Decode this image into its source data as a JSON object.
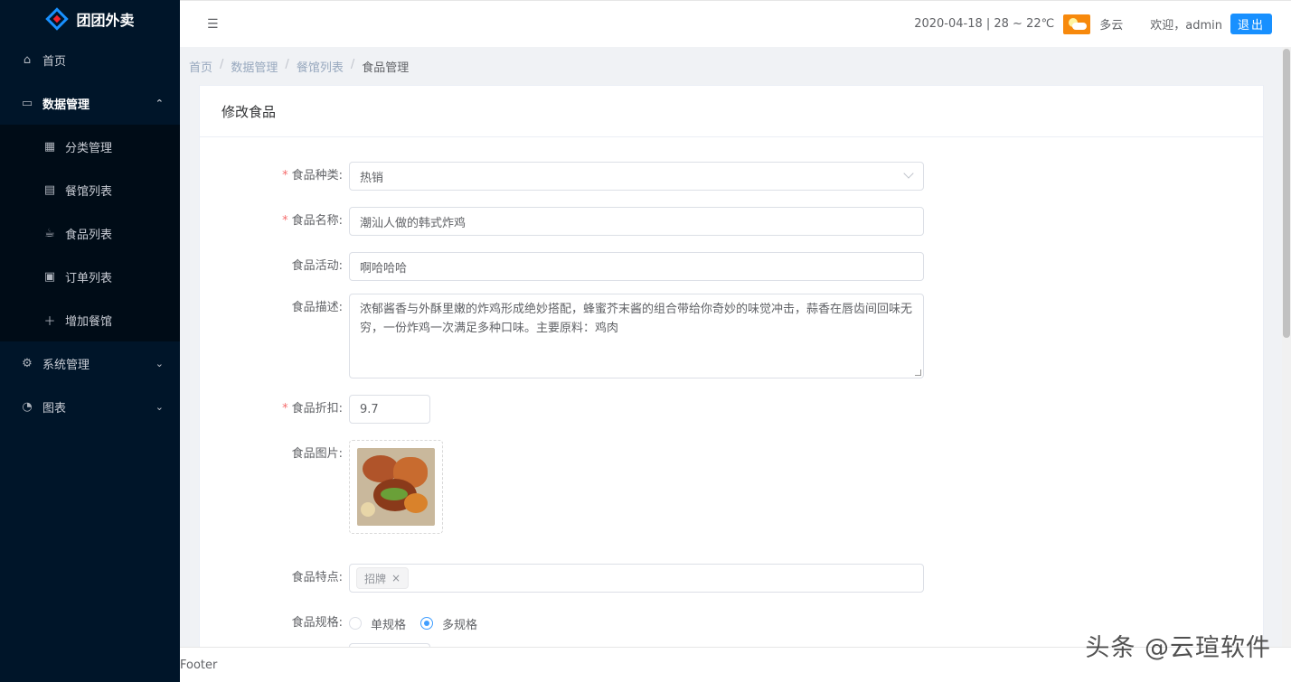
{
  "app": {
    "title": "团团外卖"
  },
  "sidebar": {
    "items": [
      {
        "label": "首页",
        "icon": "home-icon"
      },
      {
        "label": "数据管理",
        "icon": "monitor-icon"
      },
      {
        "label": "系统管理",
        "icon": "gear-icon"
      },
      {
        "label": "图表",
        "icon": "pie-chart-icon"
      }
    ],
    "submenu": [
      {
        "label": "分类管理",
        "icon": "grid-icon"
      },
      {
        "label": "餐馆列表",
        "icon": "store-icon"
      },
      {
        "label": "食品列表",
        "icon": "cup-icon"
      },
      {
        "label": "订单列表",
        "icon": "order-icon"
      },
      {
        "label": "增加餐馆",
        "icon": "plus-icon"
      }
    ]
  },
  "header": {
    "weather_text": "2020-04-18 | 28 ~ 22℃",
    "weather_desc": "多云",
    "welcome": "欢迎，admin",
    "logout": "退出"
  },
  "breadcrumb": [
    "首页",
    "数据管理",
    "餐馆列表",
    "食品管理"
  ],
  "card": {
    "title": "修改食品",
    "fields": {
      "category": {
        "label": "食品种类:",
        "value": "热销"
      },
      "name": {
        "label": "食品名称:",
        "value": "潮汕人做的韩式炸鸡"
      },
      "activity": {
        "label": "食品活动:",
        "value": "啊哈哈哈"
      },
      "description": {
        "label": "食品描述:",
        "value": "浓郁酱香与外酥里嫩的炸鸡形成绝妙搭配，蜂蜜芥末酱的组合带给你奇妙的味觉冲击，蒜香在唇齿间回味无穷，一份炸鸡一次满足多种口味。主要原料：鸡肉"
      },
      "discount": {
        "label": "食品折扣:",
        "value": "9.7"
      },
      "image": {
        "label": "食品图片:"
      },
      "features": {
        "label": "食品特点:",
        "tags": [
          "招牌"
        ]
      },
      "spec": {
        "label": "食品规格:",
        "options": [
          "单规格",
          "多规格"
        ],
        "selected": "多规格"
      }
    }
  },
  "footer": {
    "text": "Footer"
  },
  "watermark": "头条 @云瑄软件"
}
